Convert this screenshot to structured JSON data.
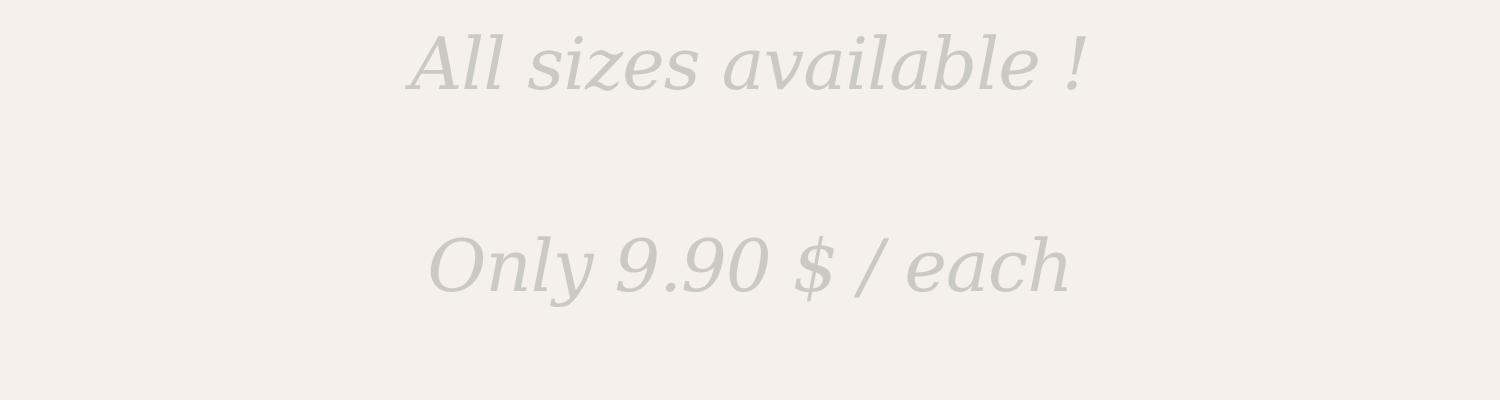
{
  "banner": {
    "availability_text": "All sizes available !",
    "price_text": "Only 9.90 $ / each"
  },
  "colors": {
    "background": "#f5f0ea",
    "text": "#cbcac0"
  }
}
